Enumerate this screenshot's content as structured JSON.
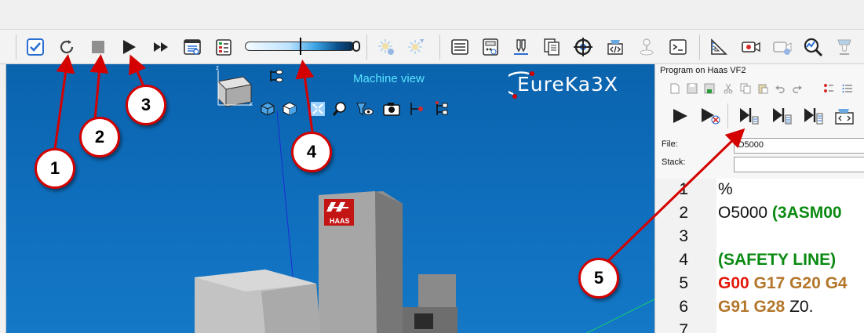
{
  "toolbar": {
    "buttons": [
      {
        "name": "checkbox-view-icon"
      },
      {
        "name": "reset-icon"
      },
      {
        "name": "stop-icon"
      },
      {
        "name": "play-icon"
      },
      {
        "name": "fast-forward-icon"
      },
      {
        "name": "calculator-panel-icon"
      },
      {
        "name": "checklist-icon"
      },
      {
        "name": "light-settings-icon"
      },
      {
        "name": "light-toggle-icon"
      },
      {
        "name": "program-listing-icon"
      },
      {
        "name": "machine-panel-icon"
      },
      {
        "name": "tool-holder-icon"
      },
      {
        "name": "documents-icon"
      },
      {
        "name": "target-icon"
      },
      {
        "name": "code-folder-icon"
      },
      {
        "name": "joystick-icon"
      },
      {
        "name": "terminal-icon"
      },
      {
        "name": "measure-icon"
      },
      {
        "name": "camera-icon"
      },
      {
        "name": "camera-settings-icon"
      },
      {
        "name": "analysis-icon"
      },
      {
        "name": "tool-icon"
      }
    ],
    "speed_level": 0.5
  },
  "viewport": {
    "title": "Machine view",
    "logo_text": "EureKa3X",
    "axis_z": "z",
    "axis_x": "x",
    "machine_brand": "HAAS"
  },
  "panel": {
    "title": "Program on Haas VF2",
    "file_label": "File:",
    "file_value": "O5000",
    "stack_label": "Stack:",
    "stack_value": "",
    "code_lines": [
      {
        "n": "1",
        "parts": [
          {
            "t": "%",
            "c": "plain"
          }
        ]
      },
      {
        "n": "2",
        "parts": [
          {
            "t": "O5000 ",
            "c": "plain"
          },
          {
            "t": "(3ASM00",
            "c": "green"
          }
        ]
      },
      {
        "n": "3",
        "parts": []
      },
      {
        "n": "4",
        "parts": [
          {
            "t": "(SAFETY LINE)",
            "c": "green"
          }
        ]
      },
      {
        "n": "5",
        "parts": [
          {
            "t": "G00 ",
            "c": "red"
          },
          {
            "t": "G17 G20 G4",
            "c": "brown"
          }
        ]
      },
      {
        "n": "6",
        "parts": [
          {
            "t": "G91 G28 ",
            "c": "brown"
          },
          {
            "t": "Z0.",
            "c": "plain"
          }
        ]
      },
      {
        "n": "7",
        "parts": []
      }
    ]
  },
  "callouts": [
    "1",
    "2",
    "3",
    "4",
    "5"
  ],
  "colors": {
    "accent_red": "#d40000",
    "viewport_blue": "#0f6fbe",
    "code_green": "#0a8a12",
    "code_red": "#e3170a",
    "code_brown": "#b3762a"
  }
}
